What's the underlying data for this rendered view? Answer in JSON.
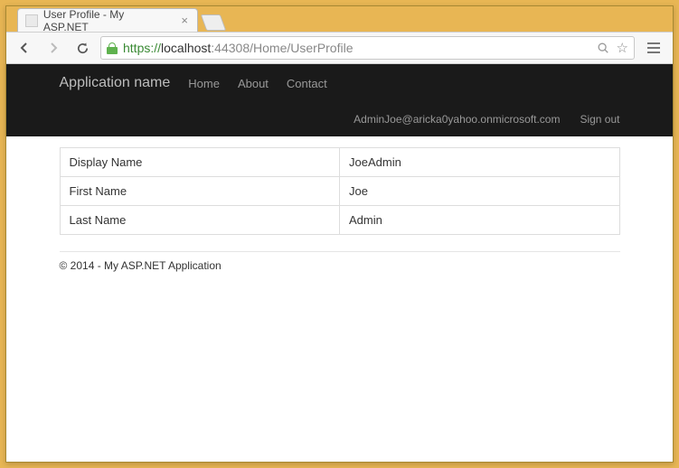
{
  "window": {
    "tab_title": "User Profile - My ASP.NET"
  },
  "address": {
    "scheme": "https",
    "host": "localhost",
    "port_path": ":44308/Home/UserProfile"
  },
  "navbar": {
    "brand": "Application name",
    "links": {
      "home": "Home",
      "about": "About",
      "contact": "Contact"
    },
    "user_email": "AdminJoe@aricka0yahoo.onmicrosoft.com",
    "sign_out": "Sign out"
  },
  "profile": {
    "rows": [
      {
        "label": "Display Name",
        "value": "JoeAdmin"
      },
      {
        "label": "First Name",
        "value": "Joe"
      },
      {
        "label": "Last Name",
        "value": "Admin"
      }
    ]
  },
  "footer": {
    "text": "© 2014 - My ASP.NET Application"
  }
}
